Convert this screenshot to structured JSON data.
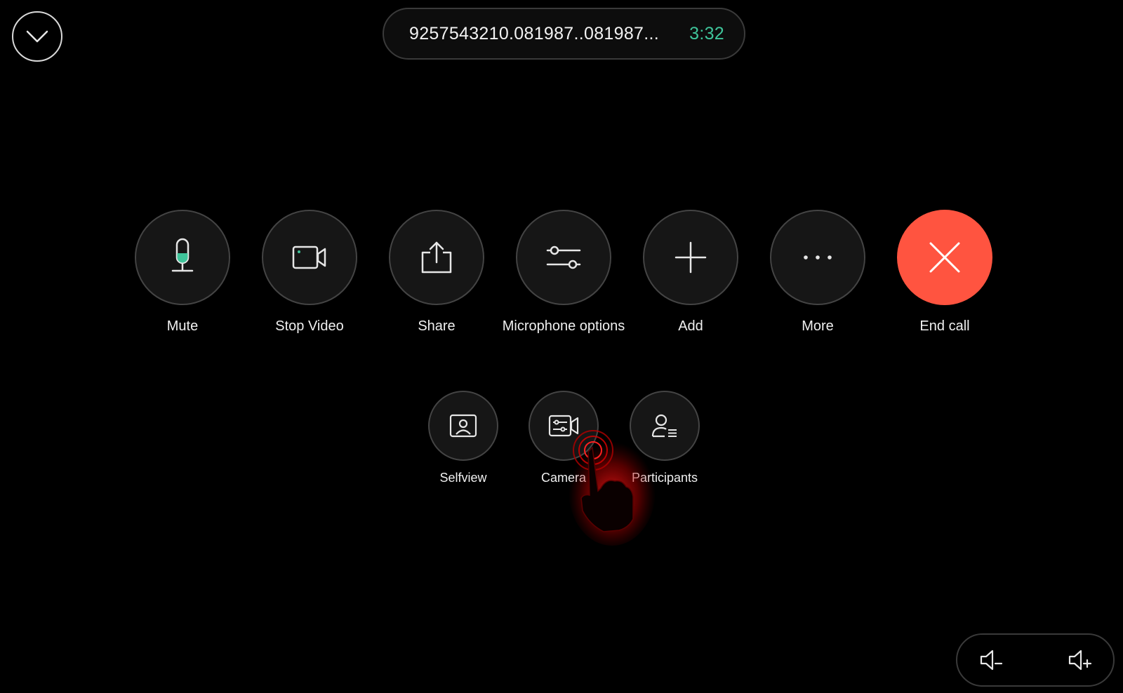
{
  "call": {
    "number": "9257543210.081987..081987...",
    "duration": "3:32"
  },
  "controls": [
    {
      "id": "mute",
      "label": "Mute",
      "icon": "microphone-icon"
    },
    {
      "id": "stop-video",
      "label": "Stop Video",
      "icon": "video-camera-icon"
    },
    {
      "id": "share",
      "label": "Share",
      "icon": "share-icon"
    },
    {
      "id": "microphone-options",
      "label": "Microphone options",
      "icon": "sliders-icon"
    },
    {
      "id": "add",
      "label": "Add",
      "icon": "plus-icon"
    },
    {
      "id": "more",
      "label": "More",
      "icon": "ellipsis-icon"
    },
    {
      "id": "end-call",
      "label": "End call",
      "icon": "close-icon"
    }
  ],
  "secondary": [
    {
      "id": "selfview",
      "label": "Selfview",
      "icon": "selfview-icon"
    },
    {
      "id": "camera",
      "label": "Camera",
      "icon": "camera-settings-icon"
    },
    {
      "id": "participants",
      "label": "Participants",
      "icon": "participants-icon"
    }
  ],
  "colors": {
    "background": "#000000",
    "timer": "#3fc49a",
    "end_call": "#ff5440",
    "mic_level": "#3fc49a"
  }
}
